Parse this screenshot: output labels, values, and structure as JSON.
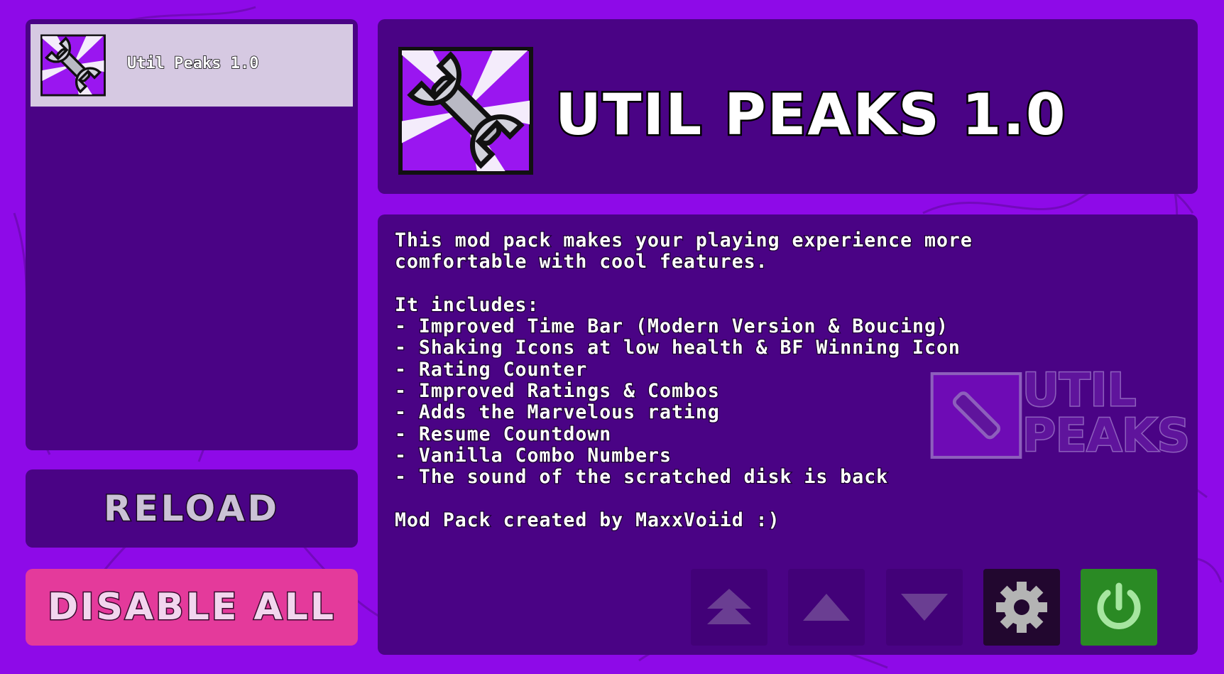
{
  "mod_list": {
    "items": [
      {
        "name": "Util Peaks 1.0",
        "icon": "wrench-icon",
        "selected": true
      }
    ]
  },
  "buttons": {
    "reload": "RELOAD",
    "disable_all": "DISABLE ALL"
  },
  "selected_mod": {
    "title": "UTIL PEAKS 1.0",
    "description": "This mod pack makes your playing experience more\ncomfortable with cool features.\n\nIt includes:\n- Improved Time Bar (Modern Version & Boucing)\n- Shaking Icons at low health & BF Winning Icon\n- Rating Counter\n- Improved Ratings & Combos\n- Adds the Marvelous rating\n- Resume Countdown\n- Vanilla Combo Numbers\n- The sound of the scratched disk is back\n\nMod Pack created by MaxxVoiid :)",
    "watermark_line1": "UTIL",
    "watermark_line2": "PEAKS"
  },
  "controls": [
    {
      "name": "move-to-top",
      "icon": "double-arrow-up-icon"
    },
    {
      "name": "move-up",
      "icon": "arrow-up-icon"
    },
    {
      "name": "move-down",
      "icon": "arrow-down-icon"
    },
    {
      "name": "settings",
      "icon": "gear-icon"
    },
    {
      "name": "toggle",
      "icon": "power-icon",
      "enabled": true
    }
  ],
  "colors": {
    "background": "#8e0ae8",
    "panel": "#4a0385",
    "selected_row": "#d6c9e2",
    "disable_button": "#e43a9b",
    "power_enabled": "#2a8a24"
  }
}
